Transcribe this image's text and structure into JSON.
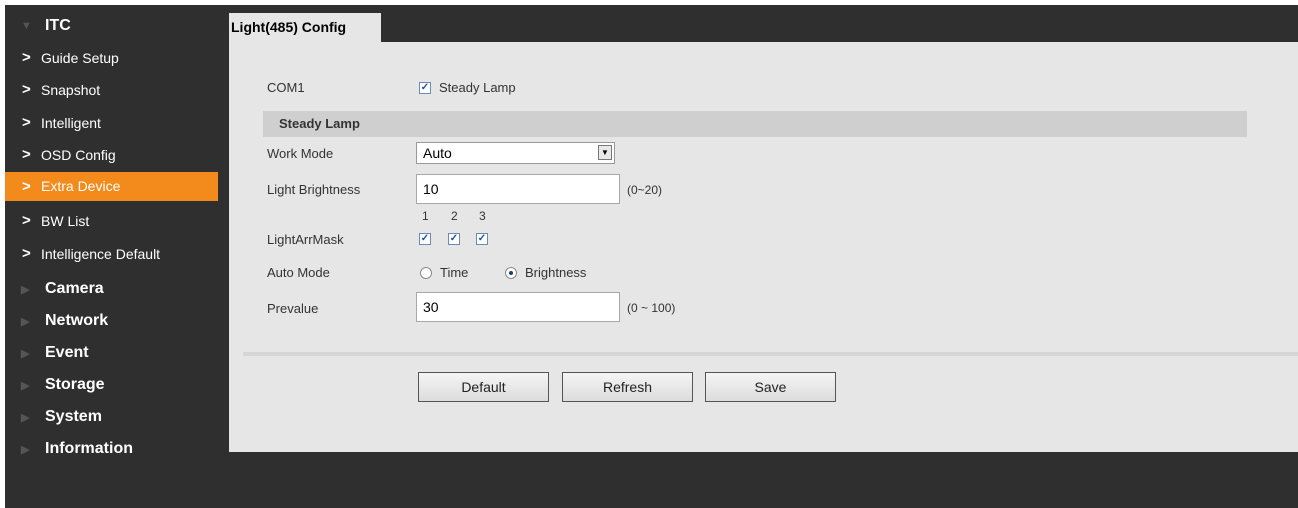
{
  "sidebar": {
    "itc": "ITC",
    "sub_items": [
      {
        "label": "Guide Setup"
      },
      {
        "label": "Snapshot"
      },
      {
        "label": "Intelligent"
      },
      {
        "label": "OSD Config"
      },
      {
        "label": "Extra Device",
        "active": true
      },
      {
        "label": "BW List"
      },
      {
        "label": "Intelligence Default"
      }
    ],
    "sections": [
      "Camera",
      "Network",
      "Event",
      "Storage",
      "System",
      "Information"
    ],
    "chevron": ">"
  },
  "tab": {
    "label": "Light(485) Config"
  },
  "form": {
    "com1_label": "COM1",
    "com1_check_label": "Steady Lamp",
    "section_title": "Steady Lamp",
    "work_mode_label": "Work Mode",
    "work_mode_value": "Auto",
    "light_brightness_label": "Light Brightness",
    "light_brightness_value": "10",
    "light_brightness_range": "(0~20)",
    "mask_label": "LightArrMask",
    "mask_numbers": [
      "1",
      "2",
      "3"
    ],
    "auto_mode_label": "Auto Mode",
    "auto_mode_options": [
      "Time",
      "Brightness"
    ],
    "auto_mode_selected": "Brightness",
    "prevalue_label": "Prevalue",
    "prevalue_value": "30",
    "prevalue_range": "(0 ~ 100)"
  },
  "buttons": {
    "default": "Default",
    "refresh": "Refresh",
    "save": "Save"
  },
  "colors": {
    "active": "#f28a1c",
    "sidebar_bg": "#2f2f2f",
    "panel_bg": "#e6e6e6"
  },
  "icons": {
    "check": "✓",
    "dropdown": "▼",
    "section_collapsed": "▶",
    "section_expanded": "▼"
  }
}
